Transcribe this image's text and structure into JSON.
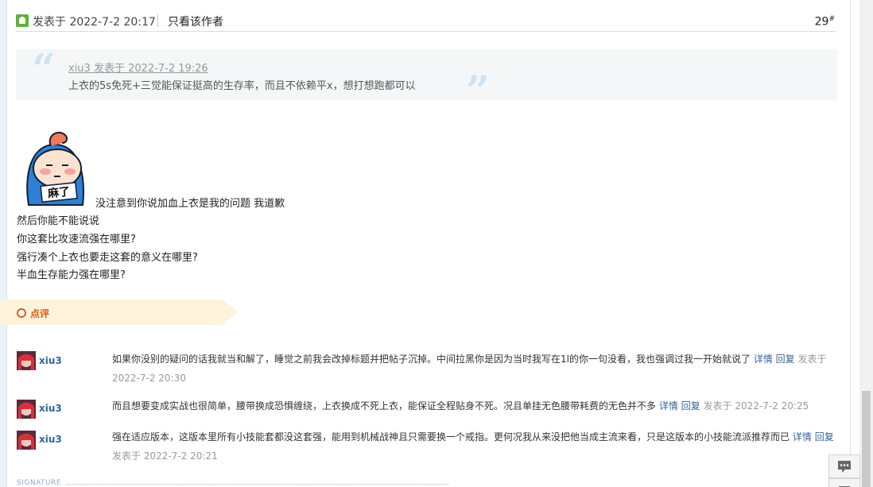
{
  "post": {
    "posted_at": "发表于 2022-7-2 20:17",
    "only_author": "只看该作者",
    "floor": "29",
    "floor_sup": "#"
  },
  "quote": {
    "author_line": "xiu3 发表于 2022-7-2 19:26",
    "text": "上衣的5s免死+三觉能保证挺高的生存率，而且不依赖平x，想打想跑都可以"
  },
  "sticker": {
    "text": "麻了"
  },
  "message": {
    "lines": [
      "没注意到你说加血上衣是我的问题 我道歉",
      "然后你能不能说说",
      "你这套比攻速流强在哪里?",
      "强行凑个上衣也要走这套的意义在哪里?",
      "半血生存能力强在哪里?"
    ]
  },
  "comments_section": {
    "label": "点评"
  },
  "comments": [
    {
      "user": "xiu3",
      "text": "如果你没别的疑问的话我就当和解了，睡觉之前我会改掉标题并把帖子沉掉。中间拉黑你是因为当时我写在1l的你一句没看，我也强调过我一开始就说了",
      "detail": "详情",
      "reply": "回复",
      "posted_prefix": "发表于",
      "posted_at": "2022-7-2 20:30"
    },
    {
      "user": "xiu3",
      "text": "而且想要变成实战也很简单，腰带换成恐惧缠绕，上衣换成不死上衣，能保证全程贴身不死。况且单挂无色腰带耗费的无色并不多",
      "detail": "详情",
      "reply": "回复",
      "posted_prefix": "发表于",
      "posted_at": "2022-7-2 20:25"
    },
    {
      "user": "xiu3",
      "text": "强在适应版本，这版本里所有小技能套都没这套强，能用到机械战神且只需要换一个戒指。更何况我从来没把他当成主流来看，只是这版本的小技能流派推荐而已",
      "detail": "详情",
      "reply": "回复",
      "posted_prefix": "发表于",
      "posted_at": "2022-7-2 20:21"
    }
  ],
  "signature": {
    "label": "SIGNATURE"
  },
  "colors": {
    "link": "#336699",
    "accent": "#e05a1f",
    "quote_bg": "#f5f6f8"
  }
}
